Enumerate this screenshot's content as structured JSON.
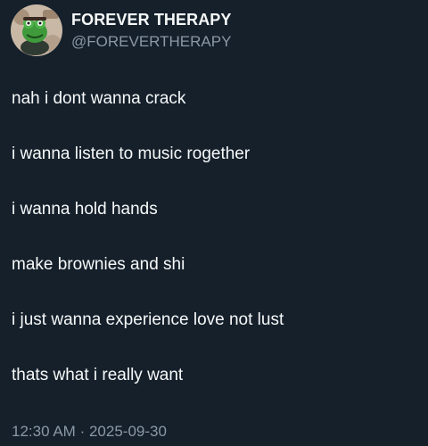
{
  "author": {
    "display_name": "FOREVER THERAPY",
    "handle": "@FOREVERTHERAPY",
    "avatar": "frog-avatar"
  },
  "post": {
    "lines": [
      "nah i dont wanna crack",
      "i wanna listen to music rogether",
      "i wanna hold hands",
      "make brownies and shi",
      "i just wanna experience love not lust",
      "thats what i really want"
    ],
    "time": "12:30 AM",
    "separator": "·",
    "date": "2025-09-30"
  },
  "colors": {
    "background": "#15202b",
    "text": "#f7f9f9",
    "secondary_text": "#8b98a5"
  }
}
